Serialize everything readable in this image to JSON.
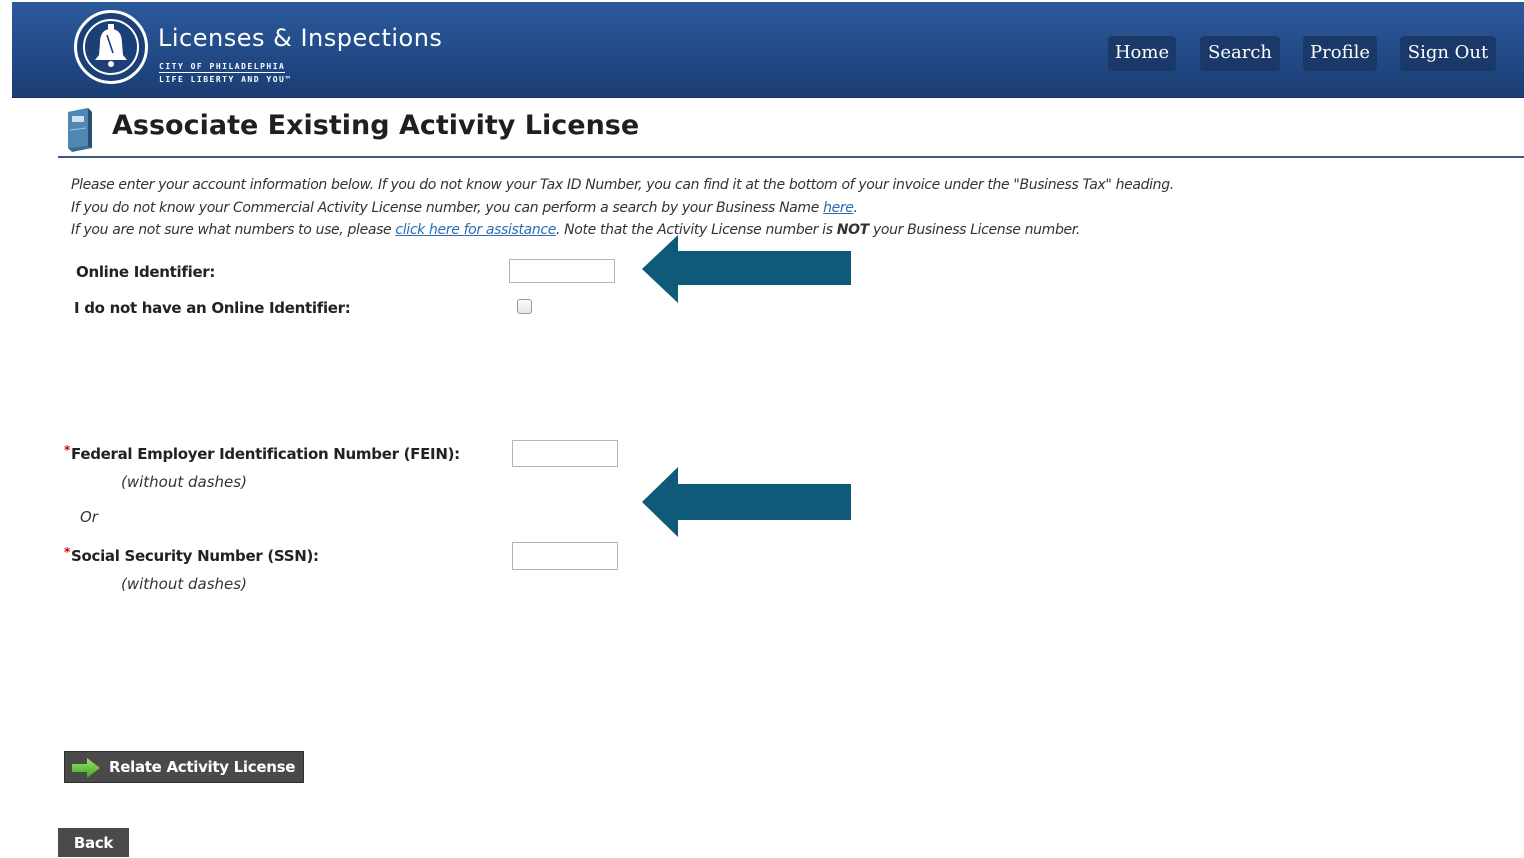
{
  "header": {
    "logo_title": "Licenses & Inspections",
    "logo_sub1": "CITY OF PHILADELPHIA",
    "logo_sub2": "LIFE LIBERTY AND YOU™",
    "nav": [
      {
        "label": "Home"
      },
      {
        "label": "Search"
      },
      {
        "label": "Profile"
      },
      {
        "label": "Sign Out"
      }
    ],
    "colors": {
      "bar": "#224a87",
      "nav_button": "#1a3968"
    }
  },
  "page": {
    "title": "Associate Existing Activity License",
    "instructions": {
      "line1": "Please enter your account information below. If you do not know your Tax ID Number, you can find it at the bottom of your invoice under the \"Business Tax\" heading.",
      "line2_pre": "If you do not know your Commercial Activity License number, you can perform a search by your Business Name ",
      "line2_link": "here",
      "line2_post": ".",
      "line3_pre": "If you are not sure what numbers to use, please ",
      "line3_link": "click here for assistance",
      "line3_mid": ". Note that the Activity License number is ",
      "line3_bold": "NOT",
      "line3_post": " your Business License number."
    }
  },
  "form": {
    "online_identifier": {
      "label": "Online Identifier:",
      "value": ""
    },
    "no_online_identifier": {
      "label": "I do not have an Online Identifier:",
      "checked": false
    },
    "fein": {
      "required_mark": "*",
      "label": "Federal Employer Identification Number (FEIN):",
      "hint": "(without dashes)",
      "value": ""
    },
    "or_text": "Or",
    "ssn": {
      "required_mark": "*",
      "label": "Social Security Number (SSN):",
      "hint": "(without dashes)",
      "value": ""
    }
  },
  "actions": {
    "relate_label": "Relate Activity License",
    "back_label": "Back"
  },
  "annotations": {
    "arrow_color": "#0f5a78"
  }
}
